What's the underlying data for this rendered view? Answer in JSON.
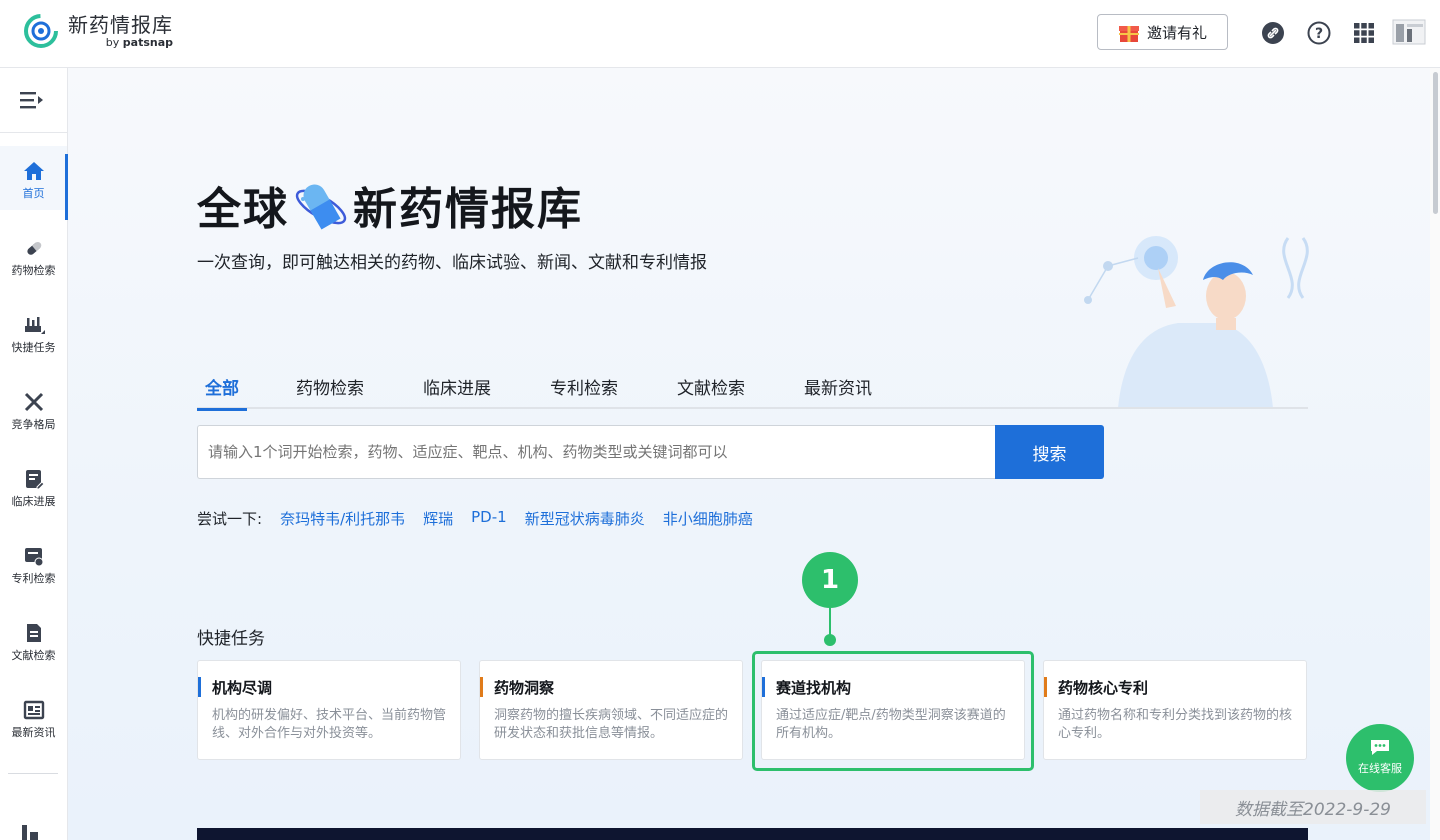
{
  "header": {
    "logo_title": "新药情报库",
    "logo_by": "by",
    "logo_brand": "patsnap",
    "invite_label": "邀请有礼"
  },
  "sidebar": {
    "items": [
      {
        "label": "首页",
        "icon": "home-icon",
        "active": true
      },
      {
        "label": "药物检索",
        "icon": "pill-icon"
      },
      {
        "label": "快捷任务",
        "icon": "task-icon"
      },
      {
        "label": "竞争格局",
        "icon": "swords-icon"
      },
      {
        "label": "临床进展",
        "icon": "clinical-icon"
      },
      {
        "label": "专利检索",
        "icon": "patent-icon"
      },
      {
        "label": "文献检索",
        "icon": "document-icon"
      },
      {
        "label": "最新资讯",
        "icon": "news-icon"
      }
    ]
  },
  "hero": {
    "title_left": "全球",
    "title_right": "新药情报库",
    "subtitle": "一次查询，即可触达相关的药物、临床试验、新闻、文献和专利情报"
  },
  "tabs": [
    "全部",
    "药物检索",
    "临床进展",
    "专利检索",
    "文献检索",
    "最新资讯"
  ],
  "search": {
    "placeholder": "请输入1个词开始检索，药物、适应症、靶点、机构、药物类型或关键词都可以",
    "button": "搜索"
  },
  "try": {
    "label": "尝试一下:",
    "suggestions": [
      "奈玛特韦/利托那韦",
      "辉瑞",
      "PD-1",
      "新型冠状病毒肺炎",
      "非小细胞肺癌"
    ]
  },
  "annotation_badge": "1",
  "quick_tasks": {
    "title": "快捷任务",
    "cards": [
      {
        "title": "机构尽调",
        "desc": "机构的研发偏好、技术平台、当前药物管线、对外合作与对外投资等。",
        "color": "#1e6fd9"
      },
      {
        "title": "药物洞察",
        "desc": "洞察药物的擅长疾病领域、不同适应症的研发状态和获批信息等情报。",
        "color": "#e07b1a"
      },
      {
        "title": "赛道找机构",
        "desc": "通过适应症/靶点/药物类型洞察该赛道的所有机构。",
        "color": "#1e6fd9"
      },
      {
        "title": "药物核心专利",
        "desc": "通过药物名称和专利分类找到该药物的核心专利。",
        "color": "#e07b1a"
      }
    ]
  },
  "chat": {
    "label": "在线客服"
  },
  "stamp": "数据截至2022-9-29"
}
